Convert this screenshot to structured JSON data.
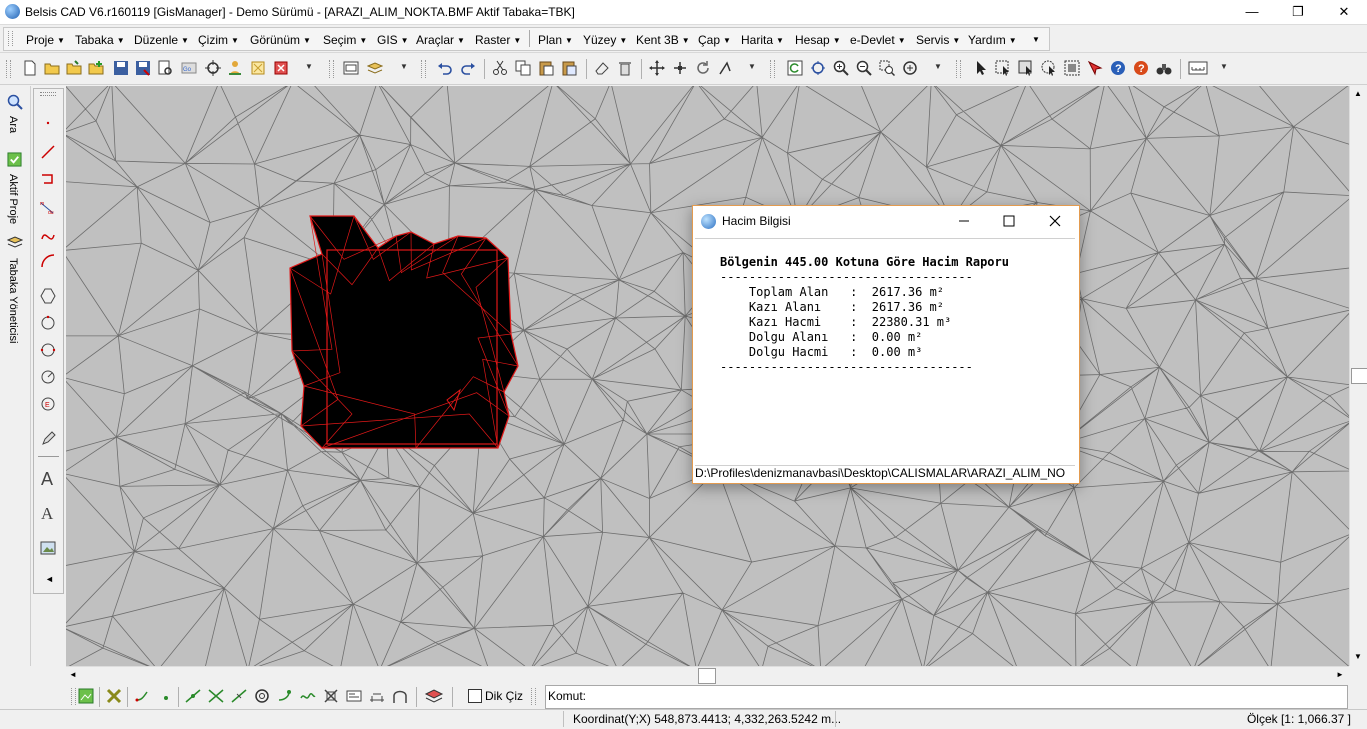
{
  "window": {
    "title": "Belsis CAD V6.r160119 [GisManager] - Demo Sürümü - [ARAZI_ALIM_NOKTA.BMF  Aktif Tabaka=TBK]",
    "controls": {
      "minimize": "—",
      "maximize": "❐",
      "close": "✕"
    }
  },
  "menu": {
    "group1": [
      "Proje",
      "Tabaka",
      "Düzenle",
      "Çizim",
      "Görünüm",
      "Seçim",
      "GIS",
      "Araçlar",
      "Raster"
    ],
    "group2": [
      "Plan",
      "Yüzey",
      "Kent 3B",
      "Çap",
      "Harita",
      "Hesap",
      "e-Devlet",
      "Servis",
      "Yardım"
    ]
  },
  "side_tabs": {
    "search": "Ara",
    "active_project": "Aktif Proje",
    "layer_manager": "Tabaka Yöneticisi"
  },
  "dialog": {
    "title": "Hacim Bilgisi",
    "heading": "Bölgenin 445.00 Kotuna Göre Hacim Raporu",
    "divider": "-----------------------------------",
    "rows": [
      {
        "label": "Toplam Alan",
        "value": "2617.36 m²"
      },
      {
        "label": "Kazı Alanı",
        "value": "2617.36 m²"
      },
      {
        "label": "Kazı Hacmi",
        "value": "22380.31 m³"
      },
      {
        "label": "Dolgu Alanı",
        "value": "0.00 m²"
      },
      {
        "label": "Dolgu Hacmi",
        "value": "0.00 m³"
      }
    ],
    "path": "D:\\Profiles\\denizmanavbasi\\Desktop\\CALISMALAR\\ARAZI_ALIM_NO"
  },
  "bottom": {
    "dik_ciz_label": "Dik Çiz",
    "command_label": "Komut:"
  },
  "status": {
    "coordinate": "Koordinat(Y;X)  548,873.4413; 4,332,263.5242 m...",
    "scale": "Ölçek [1: 1,066.37 ]"
  },
  "colors": {
    "canvas": "#c0c0c0",
    "mesh_lines": "#6e6e6e",
    "selection_outline": "#e01818",
    "fill": "#000000",
    "dialog_border": "#e39b4f"
  }
}
